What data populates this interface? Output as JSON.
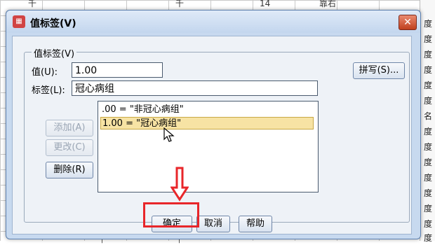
{
  "background": {
    "top_cells": [
      "千",
      "千",
      "14",
      "靠右"
    ],
    "right_col": [
      "度",
      "度",
      "度",
      "度",
      "度",
      "度",
      "名",
      "度",
      "度",
      "度",
      "度",
      "度",
      "度",
      "度",
      "度"
    ],
    "bottom_cells": [
      "千",
      "千"
    ]
  },
  "dialog": {
    "title": "值标签(V)",
    "group_label": "值标签(V)",
    "value_label": "值(U):",
    "value_input": "1.00",
    "label_label": "标签(L):",
    "label_input": "冠心病组",
    "spell_button": "拼写(S)...",
    "list_items": [
      ".00 = \"非冠心病组\"",
      "1.00 = \"冠心病组\""
    ],
    "selected_index": 1,
    "add_button": "添加(A)",
    "change_button": "更改(C)",
    "remove_button": "删除(R)",
    "ok_button": "确定",
    "cancel_button": "取消",
    "help_button": "帮助"
  },
  "colors": {
    "highlight": "#e8262a",
    "selection": "#f7e3a4"
  }
}
